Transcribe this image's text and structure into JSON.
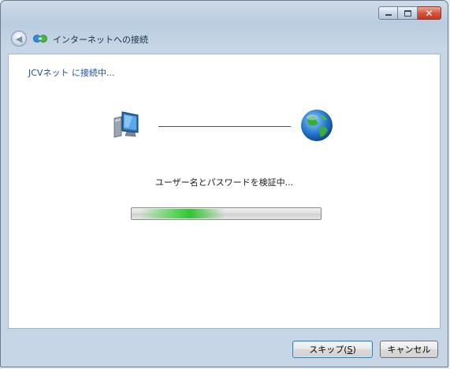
{
  "window": {
    "title": "インターネットへの接続",
    "caption_buttons": {
      "minimize": "minimize-icon",
      "maximize": "maximize-icon",
      "close": "close-icon"
    }
  },
  "navigation": {
    "back_icon": "back-arrow-icon"
  },
  "content": {
    "status_heading": "JCVネット に接続中...",
    "progress_message": "ユーザー名とパスワードを検証中...",
    "progress": {
      "animated": true,
      "glow_position": 0.2,
      "color": "#3cc83c"
    },
    "icons": {
      "left": "computer-icon",
      "right": "globe-icon"
    }
  },
  "footer": {
    "skip_text": "スキップ(",
    "skip_accel": "S",
    "skip_end": ")",
    "cancel_label": "キャンセル"
  },
  "colors": {
    "heading": "#1d52a3",
    "accent_close": "#c53a23"
  }
}
